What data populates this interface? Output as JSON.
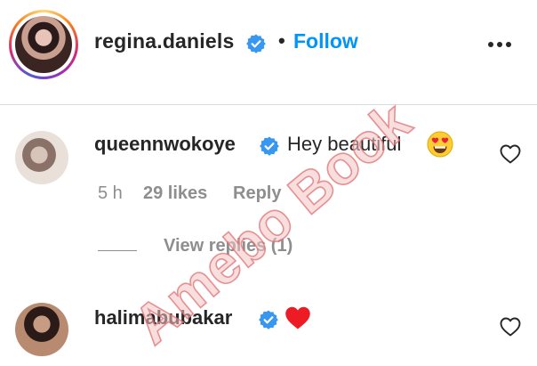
{
  "post_header": {
    "username": "regina.daniels",
    "verified": true,
    "separator": "•",
    "follow_label": "Follow",
    "more_icon": "more-horizontal-icon"
  },
  "comments": [
    {
      "username": "queennwokoye",
      "verified": true,
      "text": "Hey beautiful",
      "emoji": "smiling-face-heart-eyes-icon",
      "time": "5 h",
      "likes": "29 likes",
      "reply_label": "Reply",
      "view_replies": "View replies (1)"
    },
    {
      "username": "halimabubakar",
      "verified": true,
      "emoji": "red-heart-icon"
    }
  ],
  "watermark": "Amebo Book",
  "colors": {
    "link_blue": "#0095f6",
    "verified_blue": "#3897f0",
    "muted_gray": "#8e8e8e",
    "text_dark": "#262626",
    "heart_red": "#ed1c24",
    "watermark_red": "#e8a0a0"
  }
}
